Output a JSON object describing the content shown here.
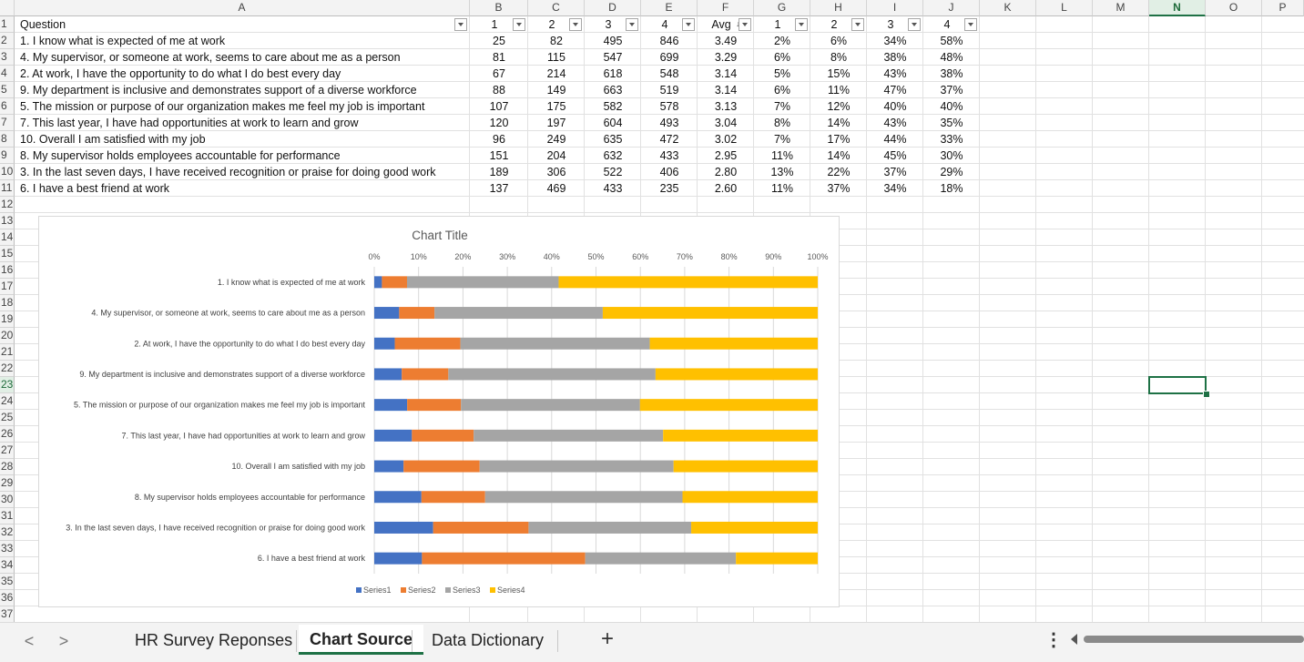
{
  "columns": [
    "A",
    "B",
    "C",
    "D",
    "E",
    "F",
    "G",
    "H",
    "I",
    "J",
    "K",
    "L",
    "M",
    "N",
    "O",
    "P"
  ],
  "selected_column": "N",
  "selected_row": 23,
  "rows": [
    1,
    2,
    3,
    4,
    5,
    6,
    7,
    8,
    9,
    10,
    11,
    12,
    13,
    14,
    15,
    16,
    17,
    18,
    19,
    20,
    21,
    22,
    23,
    24,
    25,
    26,
    27,
    28,
    29,
    30,
    31,
    32,
    33,
    34,
    35,
    36,
    37
  ],
  "header": {
    "question": "Question",
    "b": "1",
    "c": "2",
    "d": "3",
    "e": "4",
    "f": "Avg",
    "g": "1",
    "h": "2",
    "i": "3",
    "j": "4"
  },
  "table": [
    {
      "q": "1. I know what is expected of me at work",
      "b": "25",
      "c": "82",
      "d": "495",
      "e": "846",
      "avg": "3.49",
      "g": "2%",
      "h": "6%",
      "i": "34%",
      "j": "58%"
    },
    {
      "q": "4. My supervisor, or someone at work, seems to care about me as a person",
      "b": "81",
      "c": "115",
      "d": "547",
      "e": "699",
      "avg": "3.29",
      "g": "6%",
      "h": "8%",
      "i": "38%",
      "j": "48%"
    },
    {
      "q": "2. At work, I have the opportunity to do what I do best every day",
      "b": "67",
      "c": "214",
      "d": "618",
      "e": "548",
      "avg": "3.14",
      "g": "5%",
      "h": "15%",
      "i": "43%",
      "j": "38%"
    },
    {
      "q": "9. My department is inclusive and demonstrates support of a diverse workforce",
      "b": "88",
      "c": "149",
      "d": "663",
      "e": "519",
      "avg": "3.14",
      "g": "6%",
      "h": "11%",
      "i": "47%",
      "j": "37%"
    },
    {
      "q": "5. The mission or purpose of our organization makes me feel my job is important",
      "b": "107",
      "c": "175",
      "d": "582",
      "e": "578",
      "avg": "3.13",
      "g": "7%",
      "h": "12%",
      "i": "40%",
      "j": "40%"
    },
    {
      "q": "7. This last year, I have had opportunities at work to learn and grow",
      "b": "120",
      "c": "197",
      "d": "604",
      "e": "493",
      "avg": "3.04",
      "g": "8%",
      "h": "14%",
      "i": "43%",
      "j": "35%"
    },
    {
      "q": "10. Overall I am satisfied with my job",
      "b": "96",
      "c": "249",
      "d": "635",
      "e": "472",
      "avg": "3.02",
      "g": "7%",
      "h": "17%",
      "i": "44%",
      "j": "33%"
    },
    {
      "q": "8. My supervisor holds employees accountable for performance",
      "b": "151",
      "c": "204",
      "d": "632",
      "e": "433",
      "avg": "2.95",
      "g": "11%",
      "h": "14%",
      "i": "45%",
      "j": "30%"
    },
    {
      "q": "3. In the last seven days, I have received recognition or praise for doing good work",
      "b": "189",
      "c": "306",
      "d": "522",
      "e": "406",
      "avg": "2.80",
      "g": "13%",
      "h": "22%",
      "i": "37%",
      "j": "29%"
    },
    {
      "q": "6. I have a best friend at work",
      "b": "137",
      "c": "469",
      "d": "433",
      "e": "235",
      "avg": "2.60",
      "g": "11%",
      "h": "37%",
      "i": "34%",
      "j": "18%"
    }
  ],
  "chart_data": {
    "type": "bar",
    "orientation": "horizontal",
    "stacked": "percent",
    "title": "Chart Title",
    "xlim": [
      0,
      100
    ],
    "x_ticks": [
      "0%",
      "10%",
      "20%",
      "30%",
      "40%",
      "50%",
      "60%",
      "70%",
      "80%",
      "90%",
      "100%"
    ],
    "x_axis_position": "top",
    "grid": true,
    "legend_position": "bottom",
    "categories": [
      "1. I know what is expected of me at work",
      "4. My supervisor, or someone at work, seems to care about me as a person",
      "2. At work, I have the opportunity to do what I do best every day",
      "9. My department is inclusive and demonstrates support of a diverse workforce",
      "5. The mission or purpose of our organization makes me feel my job is important",
      "7. This last year, I have had opportunities at work to learn and grow",
      "10. Overall I am satisfied with my job",
      "8. My supervisor holds employees accountable for performance",
      "3. In the last seven days, I have received recognition or praise for doing good work",
      "6. I have a best friend at work"
    ],
    "series": [
      {
        "name": "Series1",
        "color": "#4472c4",
        "values": [
          25,
          81,
          67,
          88,
          107,
          120,
          96,
          151,
          189,
          137
        ]
      },
      {
        "name": "Series2",
        "color": "#ed7d31",
        "values": [
          82,
          115,
          214,
          149,
          175,
          197,
          249,
          204,
          306,
          469
        ]
      },
      {
        "name": "Series3",
        "color": "#a5a5a5",
        "values": [
          495,
          547,
          618,
          663,
          582,
          604,
          635,
          632,
          522,
          433
        ]
      },
      {
        "name": "Series4",
        "color": "#ffc000",
        "values": [
          846,
          699,
          548,
          519,
          578,
          493,
          472,
          433,
          406,
          235
        ]
      }
    ]
  },
  "tabs": {
    "prev": "<",
    "next": ">",
    "sheet1": "HR Survey Reponses",
    "sheet2": "Chart Source",
    "sheet3": "Data Dictionary",
    "add": "+",
    "more": "⋮"
  }
}
